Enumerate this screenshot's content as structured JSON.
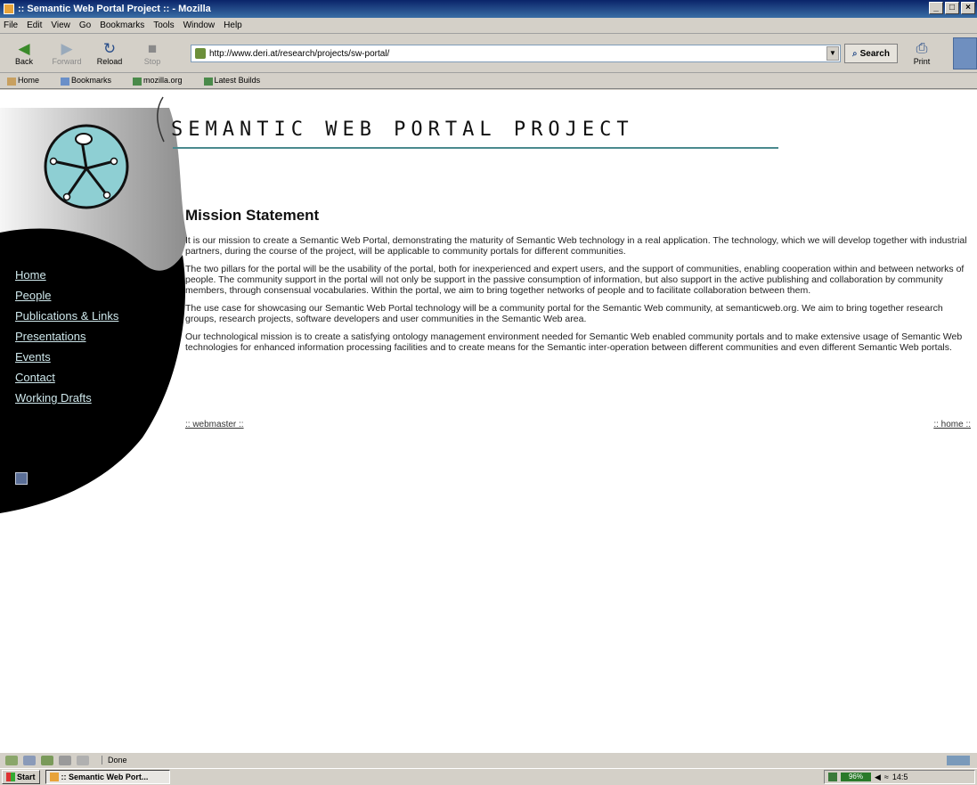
{
  "window": {
    "title": ":: Semantic Web Portal Project :: - Mozilla"
  },
  "menu": [
    "File",
    "Edit",
    "View",
    "Go",
    "Bookmarks",
    "Tools",
    "Window",
    "Help"
  ],
  "toolbar": {
    "back": "Back",
    "forward": "Forward",
    "reload": "Reload",
    "stop": "Stop",
    "url": "http://www.deri.at/research/projects/sw-portal/",
    "search": "Search",
    "print": "Print"
  },
  "bookmarks": [
    "Home",
    "Bookmarks",
    "mozilla.org",
    "Latest Builds"
  ],
  "site": {
    "banner": "SEMANTIC WEB PORTAL PROJECT",
    "nav": [
      "Home",
      "People",
      "Publications & Links",
      "Presentations",
      "Events",
      "Contact",
      "Working Drafts"
    ]
  },
  "main": {
    "heading": "Mission Statement",
    "paragraphs": [
      "It is our mission to create a Semantic Web Portal, demonstrating the maturity of Semantic Web technology in a real application. The technology, which we will develop together with industrial partners, during the course of the project, will be applicable to community portals for different communities.",
      "The two pillars for the portal will be the usability of the portal, both for inexperienced and expert users, and the support of communities, enabling cooperation within and between networks of people. The community support in the portal will not only be support in the passive consumption of information, but also support in the active publishing and collaboration by community members, through consensual vocabularies. Within the portal, we aim to bring together networks of people and to facilitate collaboration between them.",
      "The use case for showcasing our Semantic Web Portal technology will be a community portal for the Semantic Web community, at semanticweb.org. We aim to bring together research groups, research projects, software developers and user communities in the Semantic Web area.",
      "Our technological mission is to create a satisfying ontology management environment needed for Semantic Web enabled community portals and to make extensive usage of Semantic Web technologies for enhanced information processing facilities and to create means for the Semantic inter-operation between different communities and even different Semantic Web portals."
    ],
    "webmaster_link": ":: webmaster ::",
    "home_link": ":: home ::"
  },
  "status": {
    "text": "Done"
  },
  "taskbar": {
    "start": "Start",
    "task": ":: Semantic Web Port...",
    "battery": "96%",
    "clock": "14:5"
  }
}
